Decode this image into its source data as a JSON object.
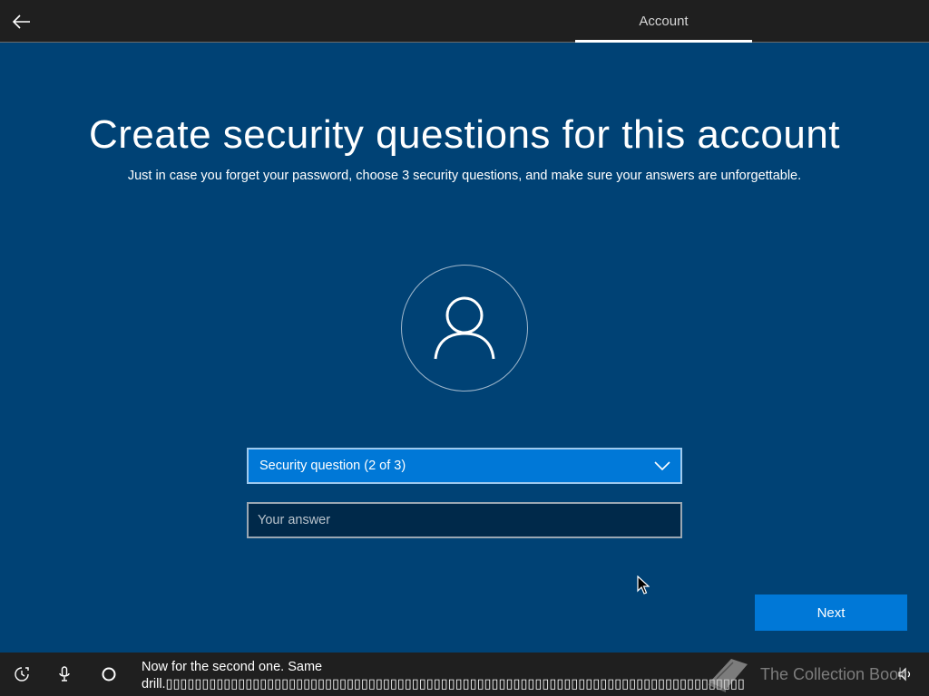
{
  "header": {
    "tab_label": "Account"
  },
  "main": {
    "title": "Create security questions for this account",
    "subtitle": "Just in case you forget your password, choose 3 security questions, and make sure your answers are unforgettable.",
    "dropdown_selected": "Security question (2 of 3)",
    "answer_placeholder": "Your answer",
    "answer_value": "",
    "next_label": "Next"
  },
  "footer": {
    "caption_line1": "Now for the second one. Same",
    "caption_line2": "drill.▯▯▯▯▯▯▯▯▯▯▯▯▯▯▯▯▯▯▯▯▯▯▯▯▯▯▯▯▯▯▯▯▯▯▯▯▯▯▯▯▯▯▯▯▯▯▯▯▯▯▯▯▯▯▯▯▯▯▯▯▯▯▯▯▯▯▯▯▯▯▯▯▯▯▯▯▯▯▯▯",
    "watermark_text": "The Collection Book"
  },
  "icons": {
    "back": "back-arrow-icon",
    "avatar": "user-icon",
    "dropdown": "chevron-down-icon",
    "ease_of_access": "ease-of-access-icon",
    "microphone": "microphone-icon",
    "cortana": "cortana-circle-icon",
    "volume": "volume-icon",
    "watermark": "book-icon"
  },
  "colors": {
    "background": "#004275",
    "accent": "#0078d7",
    "bar": "#1f1f1f",
    "input_bg": "#00294a"
  }
}
